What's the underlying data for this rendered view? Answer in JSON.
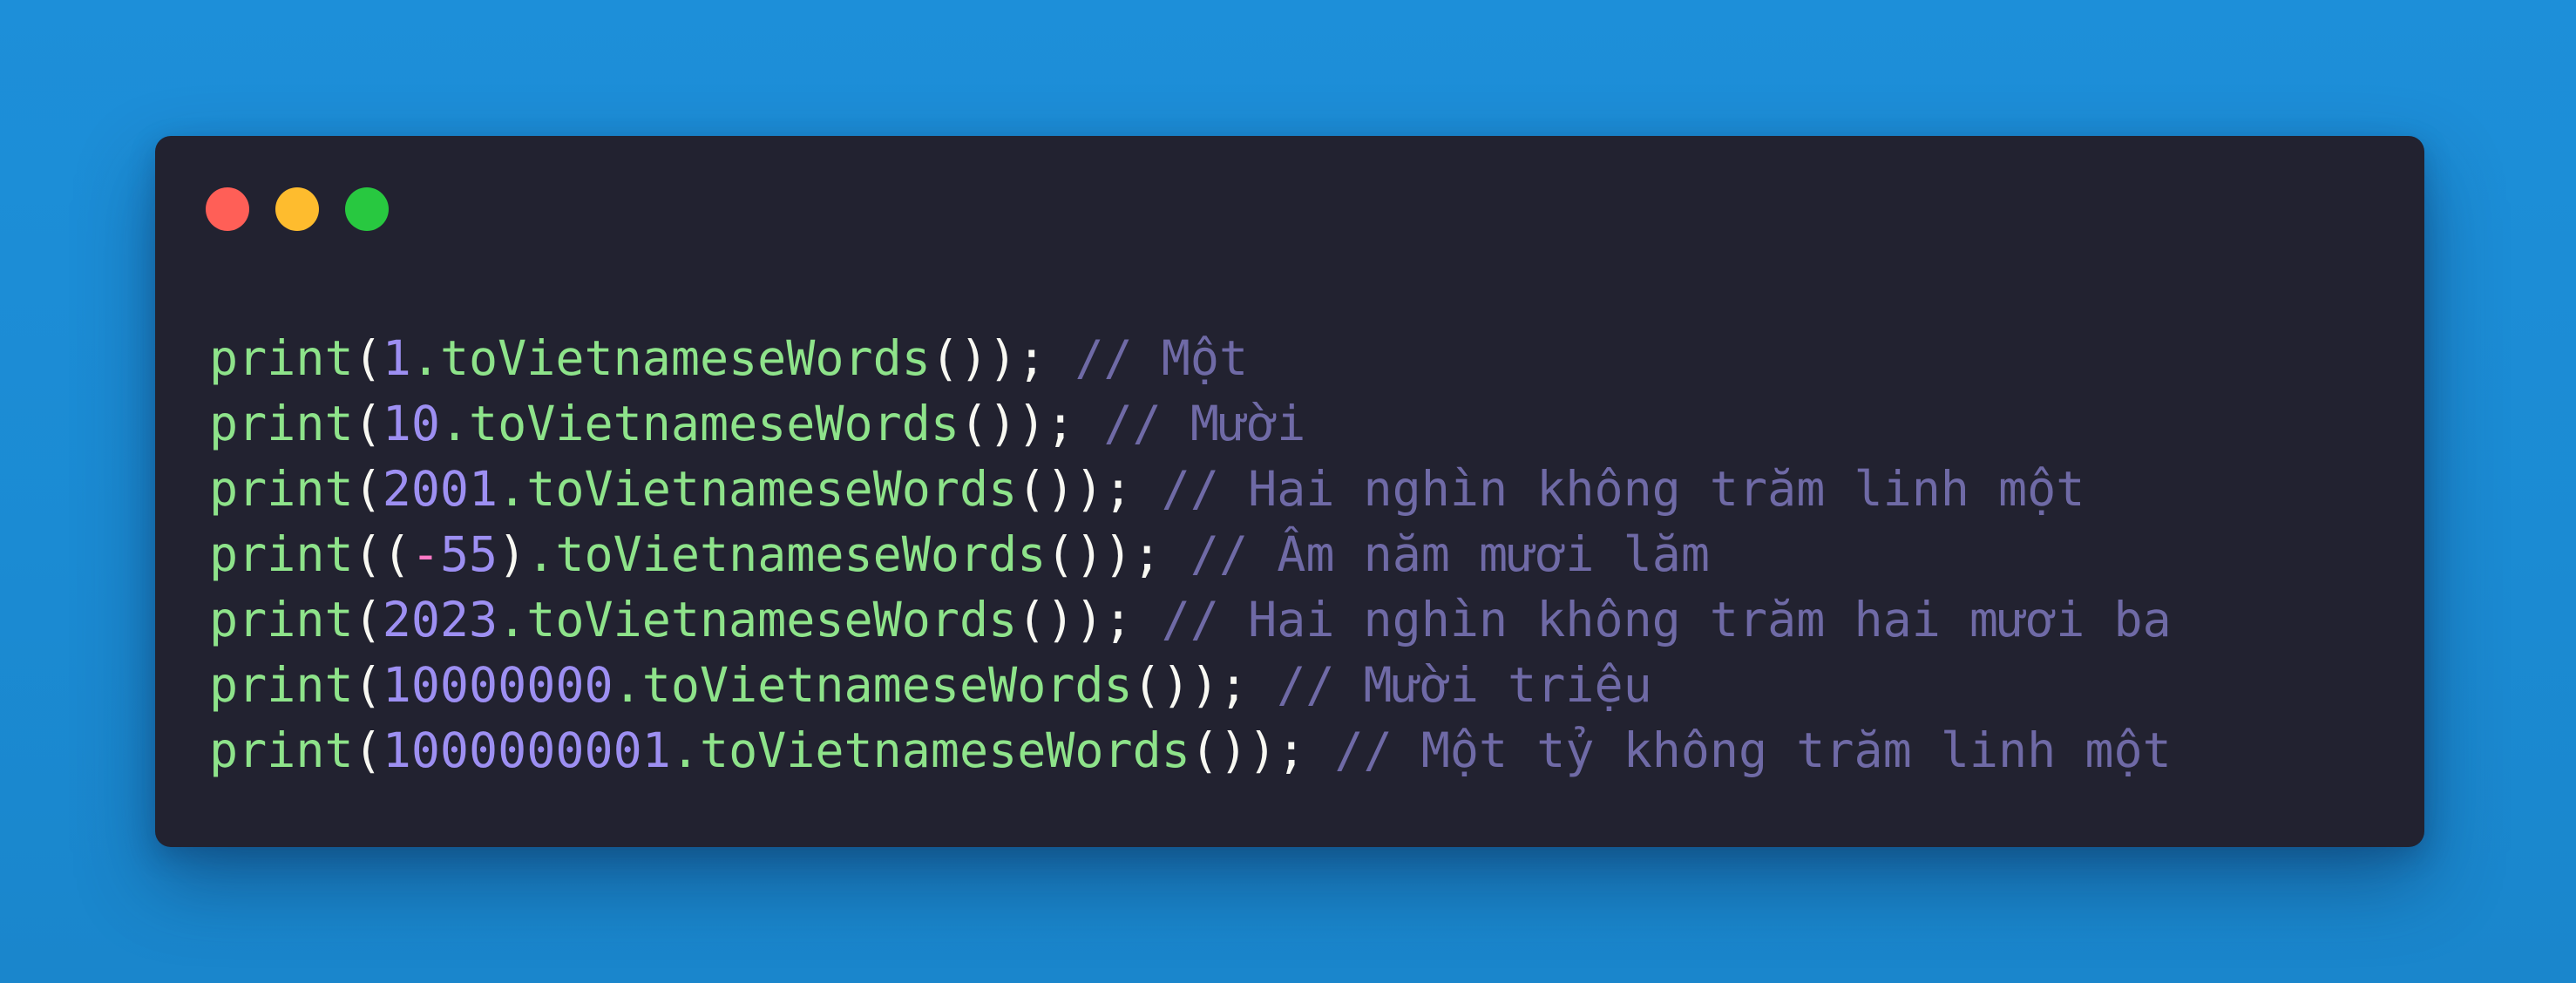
{
  "window": {
    "buttons": [
      {
        "name": "close",
        "color": "#ff5f57"
      },
      {
        "name": "minimize",
        "color": "#febc2e"
      },
      {
        "name": "maximize",
        "color": "#28c840"
      }
    ]
  },
  "code": {
    "lines": [
      {
        "fn": "print",
        "open": "(",
        "number": "1",
        "method": ".toVietnameseWords",
        "close": "());",
        "comment": "// Một"
      },
      {
        "fn": "print",
        "open": "(",
        "number": "10",
        "method": ".toVietnameseWords",
        "close": "());",
        "comment": "// Mười"
      },
      {
        "fn": "print",
        "open": "(",
        "number": "2001",
        "method": ".toVietnameseWords",
        "close": "());",
        "comment": "// Hai nghìn không trăm linh một"
      },
      {
        "fn": "print",
        "open": "((",
        "sign": "-",
        "number": "55",
        "paren_close": ")",
        "method": ".toVietnameseWords",
        "close": "());",
        "comment": "// Âm năm mươi lăm"
      },
      {
        "fn": "print",
        "open": "(",
        "number": "2023",
        "method": ".toVietnameseWords",
        "close": "());",
        "comment": "// Hai nghìn không trăm hai mươi ba"
      },
      {
        "fn": "print",
        "open": "(",
        "number": "10000000",
        "method": ".toVietnameseWords",
        "close": "());",
        "comment": "// Mười triệu"
      },
      {
        "fn": "print",
        "open": "(",
        "number": "1000000001",
        "method": ".toVietnameseWords",
        "close": "());",
        "comment": "// Một tỷ không trăm linh một"
      }
    ]
  }
}
